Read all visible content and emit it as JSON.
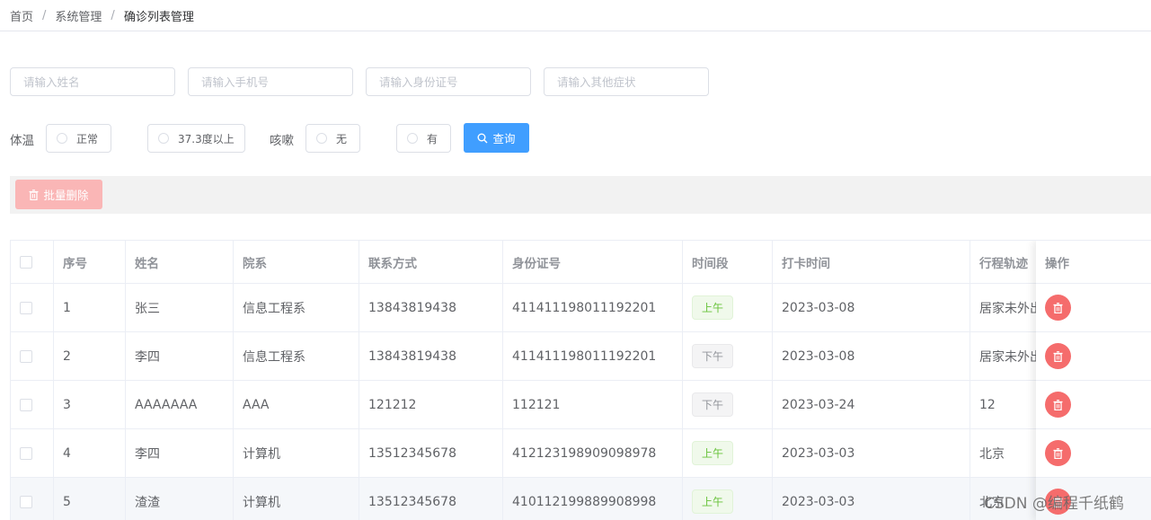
{
  "breadcrumb": [
    "首页",
    "系统管理",
    "确诊列表管理"
  ],
  "breadcrumb_sep": "/",
  "search_inputs": [
    {
      "placeholder": "请输入姓名",
      "value": ""
    },
    {
      "placeholder": "请输入手机号",
      "value": ""
    },
    {
      "placeholder": "请输入身份证号",
      "value": ""
    },
    {
      "placeholder": "请输入其他症状",
      "value": ""
    }
  ],
  "filters": {
    "temperature_label": "体温",
    "temperature_options": [
      "正常",
      "37.3度以上"
    ],
    "cough_label": "咳嗽",
    "cough_options": [
      "无",
      "有"
    ],
    "search_button": "查询"
  },
  "toolbar": {
    "batch_delete": "批量删除"
  },
  "table": {
    "columns": [
      "序号",
      "姓名",
      "院系",
      "联系方式",
      "身份证号",
      "时间段",
      "打卡时间",
      "行程轨迹",
      "操作"
    ],
    "rows": [
      {
        "id": "1",
        "name": "张三",
        "dept": "信息工程系",
        "phone": "13843819438",
        "idcard": "411411198011192201",
        "period": "上午",
        "date": "2023-03-08",
        "trip": "居家未外出"
      },
      {
        "id": "2",
        "name": "李四",
        "dept": "信息工程系",
        "phone": "13843819438",
        "idcard": "411411198011192201",
        "period": "下午",
        "date": "2023-03-08",
        "trip": "居家未外出"
      },
      {
        "id": "3",
        "name": "AAAAAAA",
        "dept": "AAA",
        "phone": "121212",
        "idcard": "112121",
        "period": "下午",
        "date": "2023-03-24",
        "trip": "12"
      },
      {
        "id": "4",
        "name": "李四",
        "dept": "计算机",
        "phone": "13512345678",
        "idcard": "412123198909098978",
        "period": "上午",
        "date": "2023-03-03",
        "trip": "北京"
      },
      {
        "id": "5",
        "name": "渣渣",
        "dept": "计算机",
        "phone": "13512345678",
        "idcard": "410112199889908998",
        "period": "上午",
        "date": "2023-03-03",
        "trip": "北京"
      }
    ]
  },
  "watermark": "CSDN @编程千纸鹤",
  "colors": {
    "primary": "#409eff",
    "danger": "#f56c6c",
    "danger_light": "#fab6b6",
    "success": "#67c23a"
  }
}
